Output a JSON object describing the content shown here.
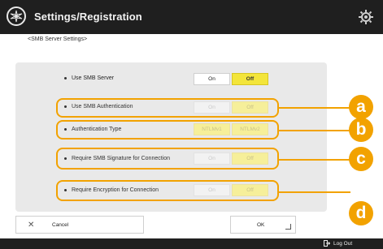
{
  "header": {
    "title": "Settings/Registration"
  },
  "screen": {
    "subtitle": "<SMB Server Settings>"
  },
  "settings": [
    {
      "label": "Use SMB Server",
      "on_label": "On",
      "off_label": "Off",
      "selected": "Off",
      "enabled": true
    },
    {
      "label": "Use SMB Authentication",
      "on_label": "On",
      "off_label": "Off",
      "selected": "Off",
      "enabled": false
    },
    {
      "label": "Authentication Type",
      "option1": "NTLMv1",
      "option2": "NTLMv2",
      "enabled": false
    },
    {
      "label": "Require SMB Signature for Connection",
      "on_label": "On",
      "off_label": "Off",
      "selected": "Off",
      "enabled": false
    },
    {
      "label": "Require Encryption for Connection",
      "on_label": "On",
      "off_label": "Off",
      "selected": "Off",
      "enabled": false
    }
  ],
  "callouts": [
    "a",
    "b",
    "c",
    "d"
  ],
  "footer": {
    "cancel_label": "Cancel",
    "ok_label": "OK"
  },
  "bottom_bar": {
    "logout_label": "Log Out"
  },
  "colors": {
    "header_bg": "#1f1f1f",
    "panel_bg": "#e9e9e9",
    "selected_off": "#f3e53a",
    "callout": "#f2a200"
  }
}
